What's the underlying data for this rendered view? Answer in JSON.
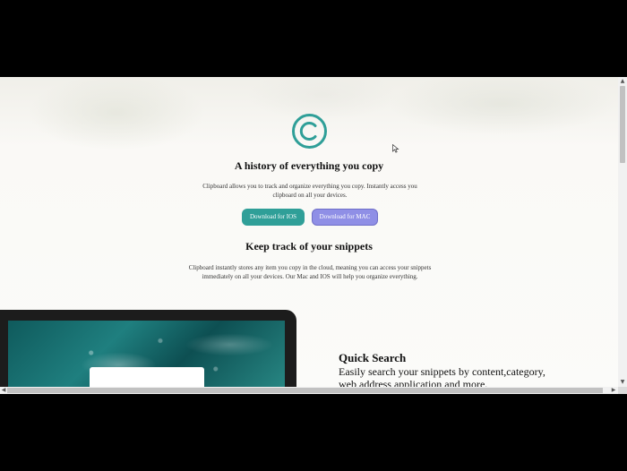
{
  "hero": {
    "title": "A history of everything you copy",
    "description": "Clipboard allows you to track and organize everything you copy. Instantly access you clipboard on all your devices.",
    "buttons": {
      "ios": "Download for IOS",
      "mac": "Download for MAC"
    }
  },
  "snippets": {
    "title": "Keep track of your snippets",
    "description": "Clipboard instantly stores any item you copy in the cloud, meaning you can access your snippets immediately on all your devices. Our Mac and IOS will help you organize everything."
  },
  "quick_search": {
    "title": "Quick Search",
    "description": "Easily search your snippets by content,category, web address application and more."
  },
  "icons": {
    "logo": "copyright-icon",
    "cursor": "mouse-pointer-icon"
  },
  "colors": {
    "accent_teal": "#2f9f98",
    "accent_purple": "#8f8fe6",
    "page_background": "#faf9f6"
  }
}
